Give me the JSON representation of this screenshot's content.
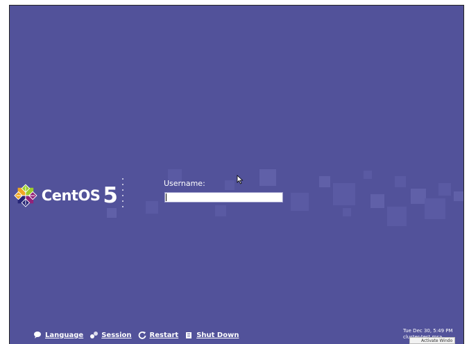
{
  "brand": {
    "name": "CentOS",
    "version": "5"
  },
  "login": {
    "username_label": "Username:",
    "username_value": ""
  },
  "bottom_bar": {
    "language": "Language",
    "session": "Session",
    "restart": "Restart",
    "shutdown": "Shut Down"
  },
  "clock": {
    "datetime": "Tue Dec 30,  5:49 PM",
    "host": "cluster-test.msa"
  },
  "overlay": {
    "activate_text": "Activate Windo"
  },
  "colors": {
    "background": "#52529a",
    "text": "#ffffff"
  }
}
